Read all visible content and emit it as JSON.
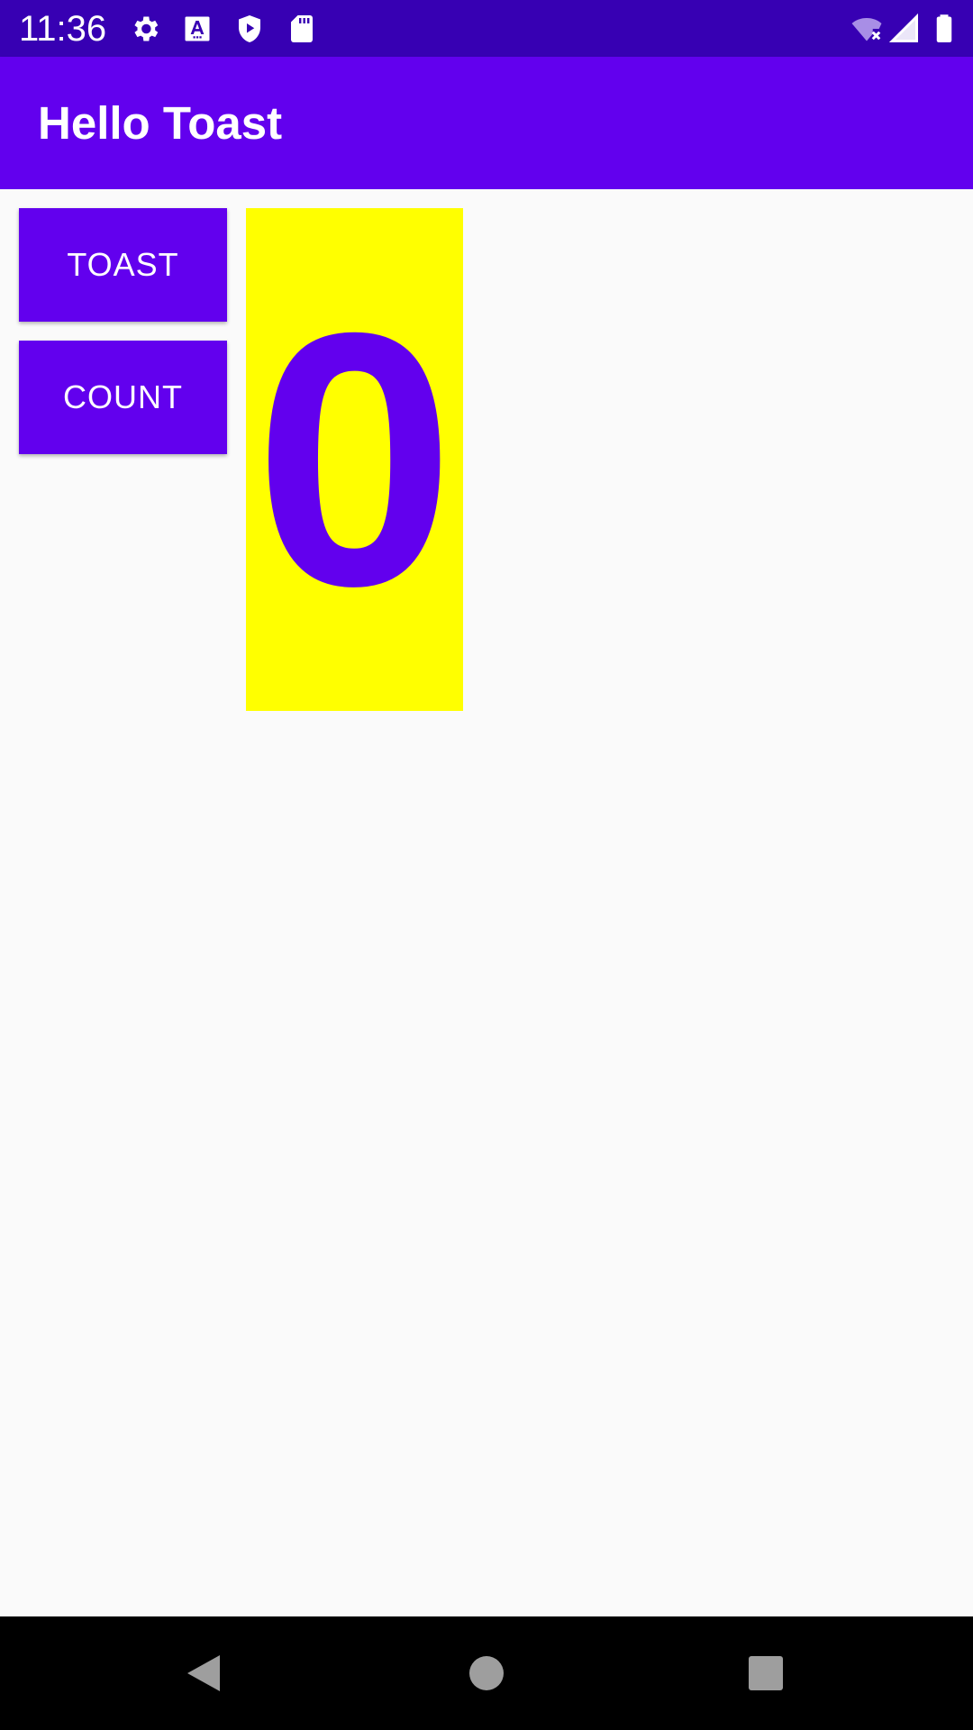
{
  "status_bar": {
    "time": "11:36",
    "icons": [
      "settings-icon",
      "text-a-icon",
      "shield-play-icon",
      "sd-card-icon",
      "wifi-off-icon",
      "signal-icon",
      "battery-icon"
    ]
  },
  "app_bar": {
    "title": "Hello Toast"
  },
  "main": {
    "toast_button_label": "TOAST",
    "count_button_label": "COUNT",
    "counter_value": "0"
  },
  "nav_bar": {
    "items": [
      "back-icon",
      "home-icon",
      "recents-icon"
    ]
  },
  "colors": {
    "status_bar": "#3700b3",
    "primary": "#6200ee",
    "counter_background": "#ffff00",
    "page_background": "#fafafa"
  }
}
